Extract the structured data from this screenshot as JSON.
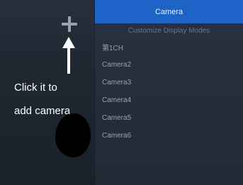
{
  "add_button": {
    "icon": "plus-icon"
  },
  "annotation": {
    "line1": "Click it to",
    "line2": "add camera"
  },
  "panel": {
    "header": "Camera",
    "subheader": "Customize Display Modes",
    "cameras": [
      {
        "label": "第1CH"
      },
      {
        "label": "Camera2"
      },
      {
        "label": "Camera3"
      },
      {
        "label": "Camera4"
      },
      {
        "label": "Camera5"
      },
      {
        "label": "Camera6"
      }
    ]
  },
  "colors": {
    "header_bg": "#1d63c8",
    "panel_bg": "#252e39",
    "annotation_text": "#ffffff"
  }
}
